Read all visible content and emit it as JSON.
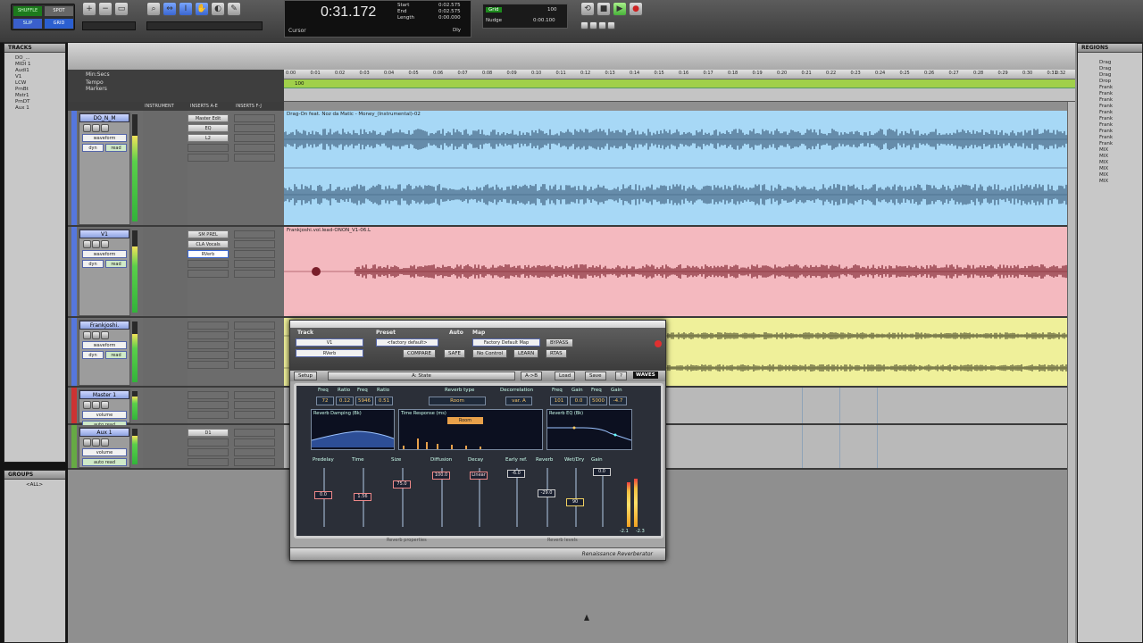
{
  "transport": {
    "counter": "0:31.172",
    "cursor_label": "Cursor",
    "start_label": "Start",
    "end_label": "End",
    "length_label": "Length",
    "start_value": "0:02.575",
    "end_value": "0:02.575",
    "length_value": "0:00.000",
    "nudge_label": "Nudge",
    "grid_label": "Grid",
    "nudge_value": "0:00.100",
    "grid_value": "100",
    "dly_label": "Dly"
  },
  "edit_modes": {
    "shuffle": "SHUFFLE",
    "spot": "SPOT",
    "slip": "SLIP",
    "grid": "GRID"
  },
  "tracks_panel": {
    "title": "TRACKS",
    "items": [
      "DO_...",
      "MIDI 1",
      "Audi1",
      "V1",
      "LCW",
      "PrnBt",
      "Mstr1",
      "PrnDT",
      "Aux 1"
    ]
  },
  "groups_panel": {
    "title": "GROUPS",
    "all_label": "<ALL>"
  },
  "regions_panel": {
    "title": "REGIONS",
    "items": [
      "Drag",
      "Drag",
      "Drag",
      "Drop",
      "Frank",
      "Frank",
      "Frank",
      "Frank",
      "Frank",
      "Frank",
      "Frank",
      "Frank",
      "Frank",
      "Frank",
      "MIX",
      "MIX",
      "MIX",
      "MIX",
      "MIX",
      "MIX"
    ]
  },
  "rulers": {
    "mins_label": "Min:Secs",
    "tempo_label": "Tempo",
    "markers_label": "Markers",
    "tempo_value": "100"
  },
  "ruler_ticks": [
    "0:00",
    "0:01",
    "0:02",
    "0:03",
    "0:04",
    "0:05",
    "0:06",
    "0:07",
    "0:08",
    "0:09",
    "0:10",
    "0:11",
    "0:12",
    "0:13",
    "0:14",
    "0:15",
    "0:16",
    "0:17",
    "0:18",
    "0:19",
    "0:20",
    "0:21",
    "0:22",
    "0:23",
    "0:24",
    "0:25",
    "0:26",
    "0:27",
    "0:28",
    "0:29",
    "0:30",
    "0:31",
    "0:32"
  ],
  "columns": {
    "instrument": "INSTRUMENT",
    "inserts_ae": "INSERTS A-E",
    "inserts_fj": "INSERTS F-J"
  },
  "tracks": [
    {
      "name": "DO_N_M",
      "view": "waveform",
      "auto": "read",
      "dyn": "dyn",
      "inserts": [
        "Master Edit",
        "EQ",
        "L2"
      ],
      "clip": "Drag-On feat. Noz da Matic - Money_(Instrumental)-02"
    },
    {
      "name": "V1",
      "view": "waveform",
      "auto": "read",
      "dyn": "dyn",
      "inserts": [
        "SM PREL",
        "CLA Vocals",
        "RVerb"
      ],
      "clip": "Frankjoshi.vol.lead-ONON_V1-06.L"
    },
    {
      "name": "Frankjoshi.",
      "view": "waveform",
      "auto": "read",
      "dyn": "dyn",
      "inserts": [],
      "clip": ""
    },
    {
      "name": "Master 1",
      "view": "volume",
      "auto": "auto read",
      "dyn": "",
      "inserts": [],
      "clip": ""
    },
    {
      "name": "Aux 1",
      "view": "volume",
      "auto": "auto read",
      "dyn": "",
      "inserts": [
        "D1"
      ],
      "clip": ""
    }
  ],
  "plugin": {
    "track_label": "Track",
    "preset_label": "Preset",
    "auto_label": "Auto",
    "map_label": "Map",
    "track_value": "V1",
    "insert_value": "RVerb",
    "preset_value": "<factory default>",
    "map_value": "Factory Default Map",
    "compare": "COMPARE",
    "safe": "SAFE",
    "bypass": "BYPASS",
    "no_control": "No Control",
    "learn": "LEARN",
    "rtas": "RTAS",
    "setup_label": "Setup",
    "state_label": "A: State",
    "ab_label": "A->B",
    "load_label": "Load",
    "save_label": "Save",
    "help_label": "?",
    "brand": "WAVES",
    "params_top": [
      "Freq",
      "Ratio",
      "Freq",
      "Ratio"
    ],
    "params_top_values": [
      "72",
      "0.12",
      "5946",
      "0.51"
    ],
    "reverb_type_label": "Reverb type",
    "reverb_type_value": "Room",
    "decorrelation_label": "Decorrelation",
    "decorrelation_value": "var. A",
    "eq_labels": [
      "Freq",
      "Gain",
      "Freq",
      "Gain"
    ],
    "eq_values": [
      "101",
      "0.0",
      "5000",
      "-4.7"
    ],
    "graph1_title": "Reverb Damping (Bk)",
    "graph2_title": "Time Response (ms)",
    "graph3_title": "Reverb EQ (Bk)",
    "graph2_mode": "Room",
    "fader_labels": [
      "Predelay",
      "Time",
      "Size",
      "Diffusion",
      "Decay"
    ],
    "fader_values": [
      "0.0",
      "1.56",
      "75.0",
      "100.0",
      "Linear"
    ],
    "mix_labels": [
      "Early ref.",
      "Reverb",
      "Wet/Dry",
      "Gain"
    ],
    "mix_values": [
      "-6.0",
      "-29.0",
      "90",
      "0.0"
    ],
    "meter_values": [
      "-2.1",
      "-2.3"
    ],
    "footer_left": "Reverb properties",
    "footer_mid": "Reverb levels",
    "product": "Renaissance Reverberator"
  },
  "colors": {
    "track1_clip": "#a7d8f6",
    "track2_clip": "#f4b9bf",
    "track3_clip": "#eff09a",
    "tempo_bar": "#a0d04a"
  }
}
